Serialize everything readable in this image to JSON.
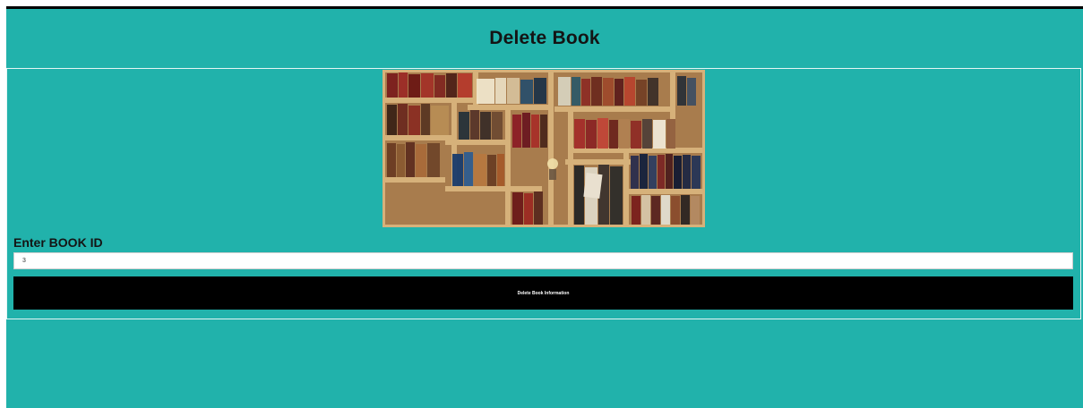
{
  "page": {
    "title": "Delete Book"
  },
  "image": {
    "icon": "bookshelf-image"
  },
  "form": {
    "book_id_label": "Enter BOOK ID",
    "book_id_value": "3",
    "submit_label": "Delete Book Information"
  },
  "colors": {
    "background": "#21b2ab",
    "heading": "#141414",
    "button": "#000000",
    "button_text": "#ffffff",
    "input_background": "#ffffff"
  }
}
